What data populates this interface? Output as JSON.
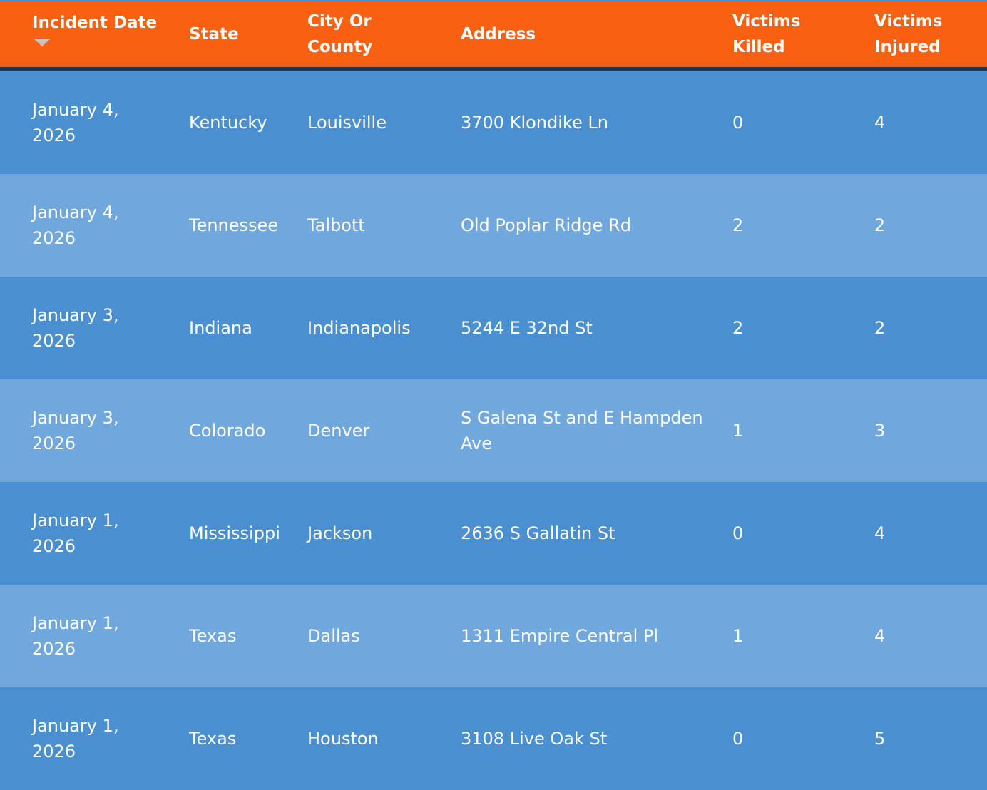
{
  "table": {
    "columns": [
      {
        "label": "Incident Date",
        "sort": "descending"
      },
      {
        "label": "State"
      },
      {
        "label": "City Or\nCounty"
      },
      {
        "label": "Address"
      },
      {
        "label": "Victims\nKilled"
      },
      {
        "label": "Victims\nInjured"
      }
    ],
    "rows": [
      {
        "date": "January 4, 2026",
        "state": "Kentucky",
        "city": "Louisville",
        "address": "3700 Klondike Ln",
        "killed": "0",
        "injured": "4"
      },
      {
        "date": "January 4, 2026",
        "state": "Tennessee",
        "city": "Talbott",
        "address": "Old Poplar Ridge Rd",
        "killed": "2",
        "injured": "2"
      },
      {
        "date": "January 3, 2026",
        "state": "Indiana",
        "city": "Indianapolis",
        "address": "5244 E 32nd St",
        "killed": "2",
        "injured": "2"
      },
      {
        "date": "January 3, 2026",
        "state": "Colorado",
        "city": "Denver",
        "address": "S Galena St and E Hampden Ave",
        "killed": "1",
        "injured": "3"
      },
      {
        "date": "January 1, 2026",
        "state": "Mississippi",
        "city": "Jackson",
        "address": "2636 S Gallatin St",
        "killed": "0",
        "injured": "4"
      },
      {
        "date": "January 1, 2026",
        "state": "Texas",
        "city": "Dallas",
        "address": "1311 Empire Central Pl",
        "killed": "1",
        "injured": "4"
      },
      {
        "date": "January 1, 2026",
        "state": "Texas",
        "city": "Houston",
        "address": "3108 Live Oak St",
        "killed": "0",
        "injured": "5"
      }
    ]
  },
  "colors": {
    "header_bg": "#f96011",
    "header_border": "#1f3552",
    "row_dark": "#4a8fd0",
    "row_light": "#70a7dc",
    "text": "#ffffff"
  },
  "icons": {
    "sort": "sort-descending-icon"
  }
}
